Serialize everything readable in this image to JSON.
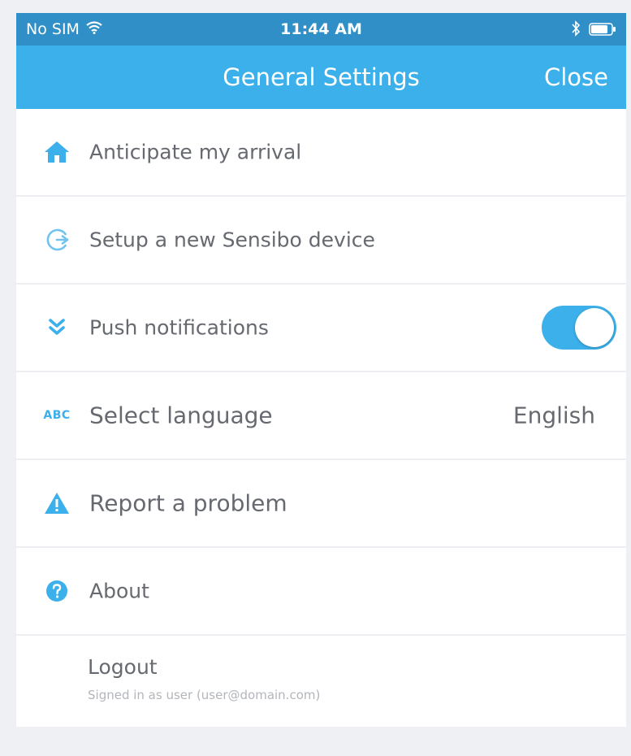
{
  "status_bar": {
    "carrier": "No SIM",
    "time": "11:44 AM"
  },
  "nav": {
    "title": "General Settings",
    "close_label": "Close"
  },
  "settings": {
    "anticipate": {
      "label": "Anticipate my arrival",
      "icon": "home-icon"
    },
    "setup": {
      "label": "Setup a new Sensibo device",
      "icon": "setup-device-icon"
    },
    "push": {
      "label": "Push notifications",
      "icon": "chevrons-down-icon",
      "enabled": true
    },
    "language": {
      "label": "Select language",
      "value": "English",
      "icon_text": "ABC"
    },
    "report": {
      "label": "Report a problem",
      "icon": "warning-icon"
    },
    "about": {
      "label": "About",
      "icon": "help-icon"
    },
    "logout": {
      "label": "Logout",
      "signed_in_text": "Signed in as user (user@domain.com)"
    }
  },
  "colors": {
    "accent": "#3cb0ea",
    "status_bar": "#2f8fc6",
    "text": "#666a70"
  }
}
